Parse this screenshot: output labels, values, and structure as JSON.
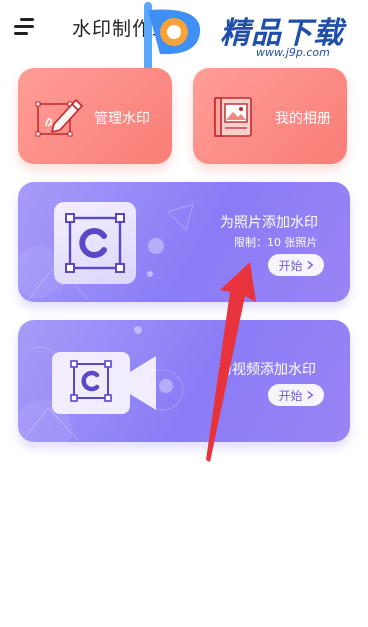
{
  "header": {
    "title": "水印制作工具",
    "menu_icon": "menu-icon"
  },
  "watermark": {
    "name": "精品下载",
    "url": "www.j9p.com",
    "brand_color": "#1f4fa8",
    "accent_color": "#f8a33a"
  },
  "cards": {
    "manage": {
      "label": "管理水印",
      "icon": "edit-certificate-icon"
    },
    "album": {
      "label": "我的相册",
      "icon": "photo-album-icon"
    },
    "photo": {
      "title": "为照片添加水印",
      "limit": "限制：10 张照片",
      "button": "开始",
      "icon": "copyright-c-icon"
    },
    "video": {
      "title": "为视频添加水印",
      "button": "开始",
      "icon": "video-camera-c-icon"
    }
  },
  "colors": {
    "coral_card": "#f97d77",
    "purple_card": "#8a7cf6",
    "annotation_arrow": "#e8333d"
  }
}
